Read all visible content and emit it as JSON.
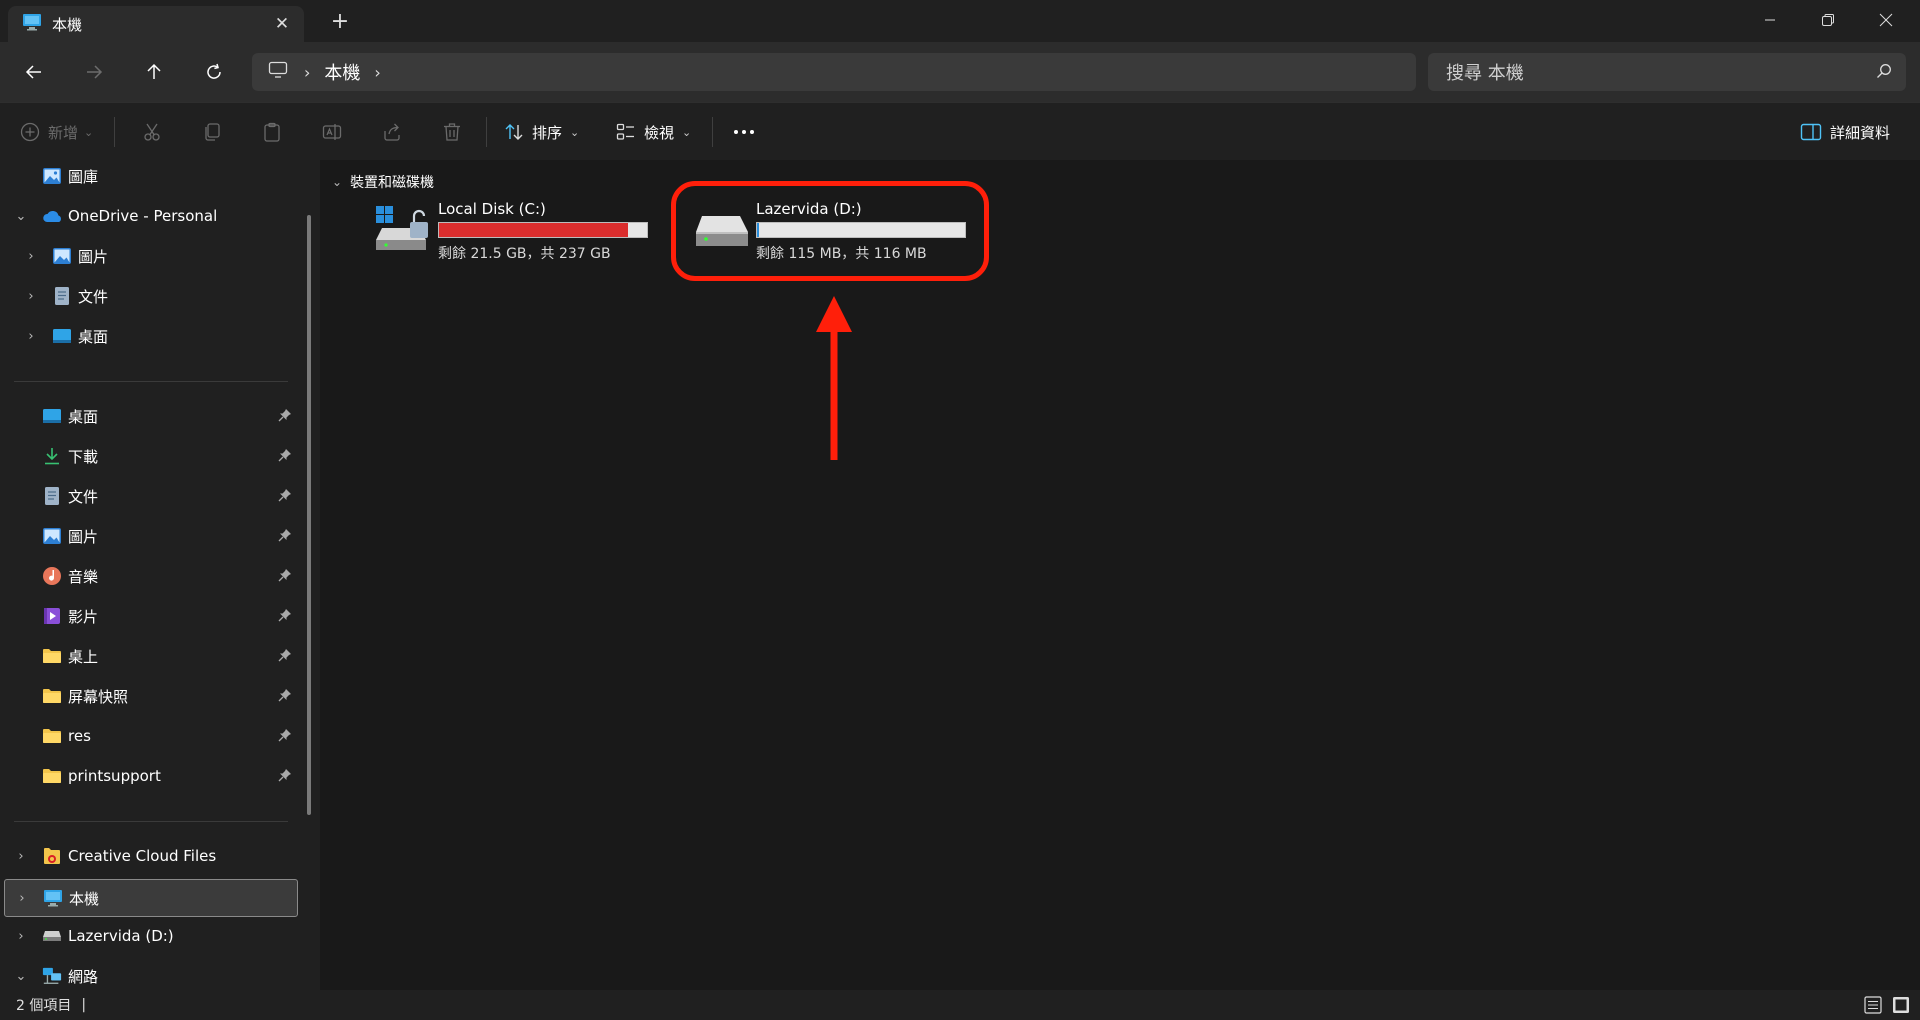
{
  "window": {
    "tab_title": "本機",
    "new_tab": "+",
    "close_tab": "✕"
  },
  "address": {
    "crumbs": [
      "本機"
    ],
    "search_placeholder": "搜尋 本機"
  },
  "commandbar": {
    "new_label": "新增",
    "sort_label": "排序",
    "view_label": "檢視",
    "details_label": "詳細資料"
  },
  "sidebar": {
    "top": [
      {
        "label": "圖庫",
        "icon": "gallery-icon"
      },
      {
        "label": "OneDrive - Personal",
        "icon": "onedrive-icon",
        "expanded": true
      },
      {
        "label": "圖片",
        "icon": "pictures-icon"
      },
      {
        "label": "文件",
        "icon": "documents-icon"
      },
      {
        "label": "桌面",
        "icon": "desktop-icon"
      }
    ],
    "pinned": [
      {
        "label": "桌面",
        "icon": "desktop-icon"
      },
      {
        "label": "下載",
        "icon": "download-icon"
      },
      {
        "label": "文件",
        "icon": "documents-icon"
      },
      {
        "label": "圖片",
        "icon": "pictures-icon"
      },
      {
        "label": "音樂",
        "icon": "music-icon"
      },
      {
        "label": "影片",
        "icon": "videos-icon"
      },
      {
        "label": "桌上",
        "icon": "folder-icon"
      },
      {
        "label": "屏幕快照",
        "icon": "folder-icon"
      },
      {
        "label": "res",
        "icon": "folder-icon"
      },
      {
        "label": "printsupport",
        "icon": "folder-icon"
      }
    ],
    "locations": [
      {
        "label": "Creative Cloud Files",
        "icon": "creative-cloud-icon"
      },
      {
        "label": "本機",
        "icon": "this-pc-icon",
        "selected": true
      },
      {
        "label": "Lazervida (D:)",
        "icon": "drive-icon"
      },
      {
        "label": "網路",
        "icon": "network-icon",
        "expanded": true
      }
    ]
  },
  "content": {
    "group_title": "裝置和磁碟機",
    "drives": [
      {
        "name": "Local Disk (C:)",
        "space": "剩餘 21.5 GB，共 237 GB",
        "used_fraction": 0.91,
        "bar_color": "#da2d2d"
      },
      {
        "name": "Lazervida (D:)",
        "space": "剩餘 115 MB，共 116 MB",
        "used_fraction": 0.01,
        "bar_color": "#2a8fdc"
      }
    ]
  },
  "status": {
    "item_count": "2 個項目",
    "cursor": "|"
  },
  "colors": {
    "annotation": "#ff1f0a"
  }
}
